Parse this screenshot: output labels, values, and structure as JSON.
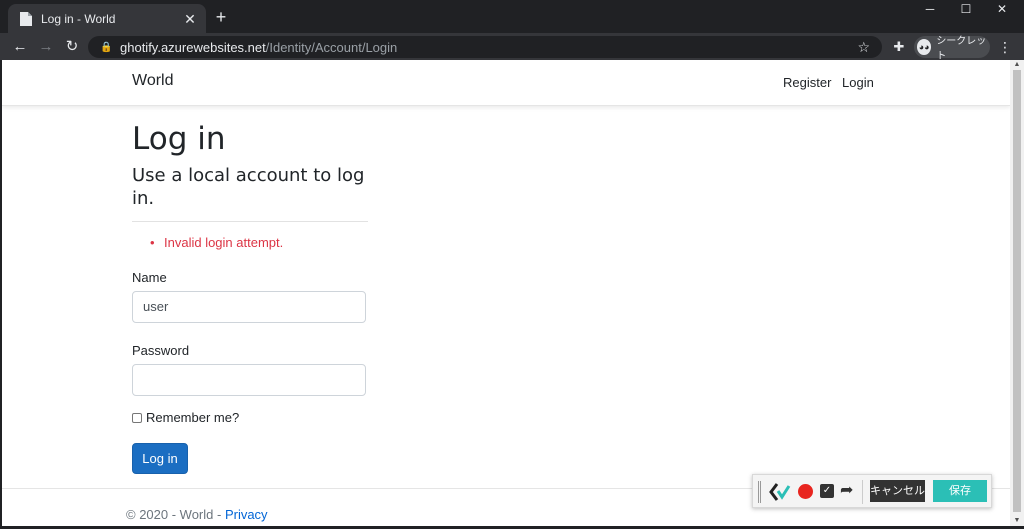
{
  "browser": {
    "tab_title": "Log in - World",
    "url_host": "ghotify.azurewebsites.net",
    "url_path": "/Identity/Account/Login",
    "incognito_label": "シークレット"
  },
  "site": {
    "brand": "World",
    "nav": {
      "register": "Register",
      "login": "Login"
    }
  },
  "login": {
    "title": "Log in",
    "subtitle": "Use a local account to log in.",
    "errors": [
      "Invalid login attempt."
    ],
    "name_label": "Name",
    "name_value": "user",
    "password_label": "Password",
    "password_value": "",
    "remember_label": "Remember me?",
    "remember_checked": false,
    "submit_label": "Log in"
  },
  "footer": {
    "copyright": "© 2020 - World - ",
    "privacy": "Privacy"
  },
  "recorder": {
    "cancel_label": "キャンセル",
    "save_label": "保存"
  },
  "colors": {
    "primary_button": "#1b6ec2",
    "error_text": "#dc3545",
    "record_red": "#e8251f",
    "save_teal": "#2bbfb6"
  },
  "icons": [
    "page-favicon-icon",
    "close-icon",
    "plus-icon",
    "back-arrow-icon",
    "forward-arrow-icon",
    "reload-icon",
    "lock-icon",
    "star-icon",
    "puzzle-extension-icon",
    "incognito-icon",
    "kebab-menu-icon",
    "record-icon",
    "check-icon",
    "share-arrow-icon"
  ]
}
